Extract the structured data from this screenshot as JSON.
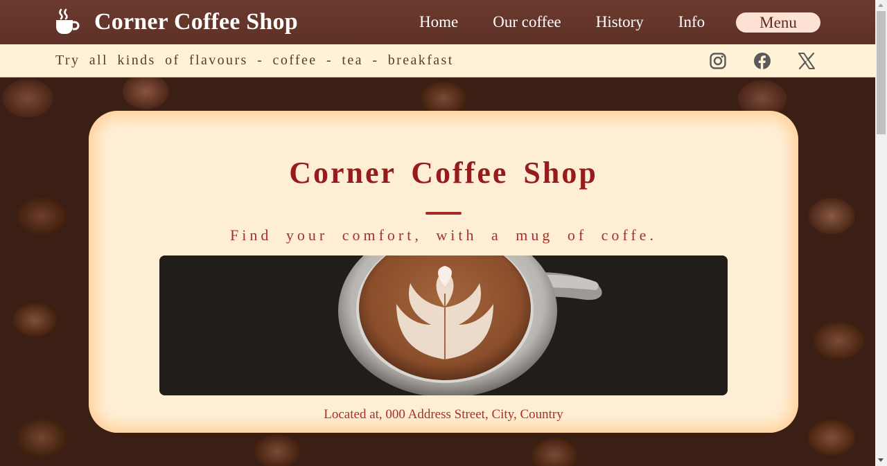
{
  "header": {
    "brand_title": "Corner Coffee Shop",
    "nav": [
      {
        "label": "Home"
      },
      {
        "label": "Our coffee"
      },
      {
        "label": "History"
      },
      {
        "label": "Info"
      }
    ],
    "menu_button": "Menu"
  },
  "subbar": {
    "tagline": "Try all kinds of flavours - coffee - tea - breakfast",
    "social_icons": [
      "instagram-icon",
      "facebook-icon",
      "x-icon"
    ]
  },
  "hero": {
    "title": "Corner Coffee Shop",
    "subtitle": "Find your comfort, with a mug of coffe.",
    "location": "Located at, 000 Address Street, City, Country"
  },
  "colors": {
    "header_bg": "#6c3a2e",
    "subbar_bg": "#fff2d6",
    "card_bg": "#ffeed6",
    "accent_red": "#961b1b",
    "menu_button_bg": "#fde1d2"
  }
}
